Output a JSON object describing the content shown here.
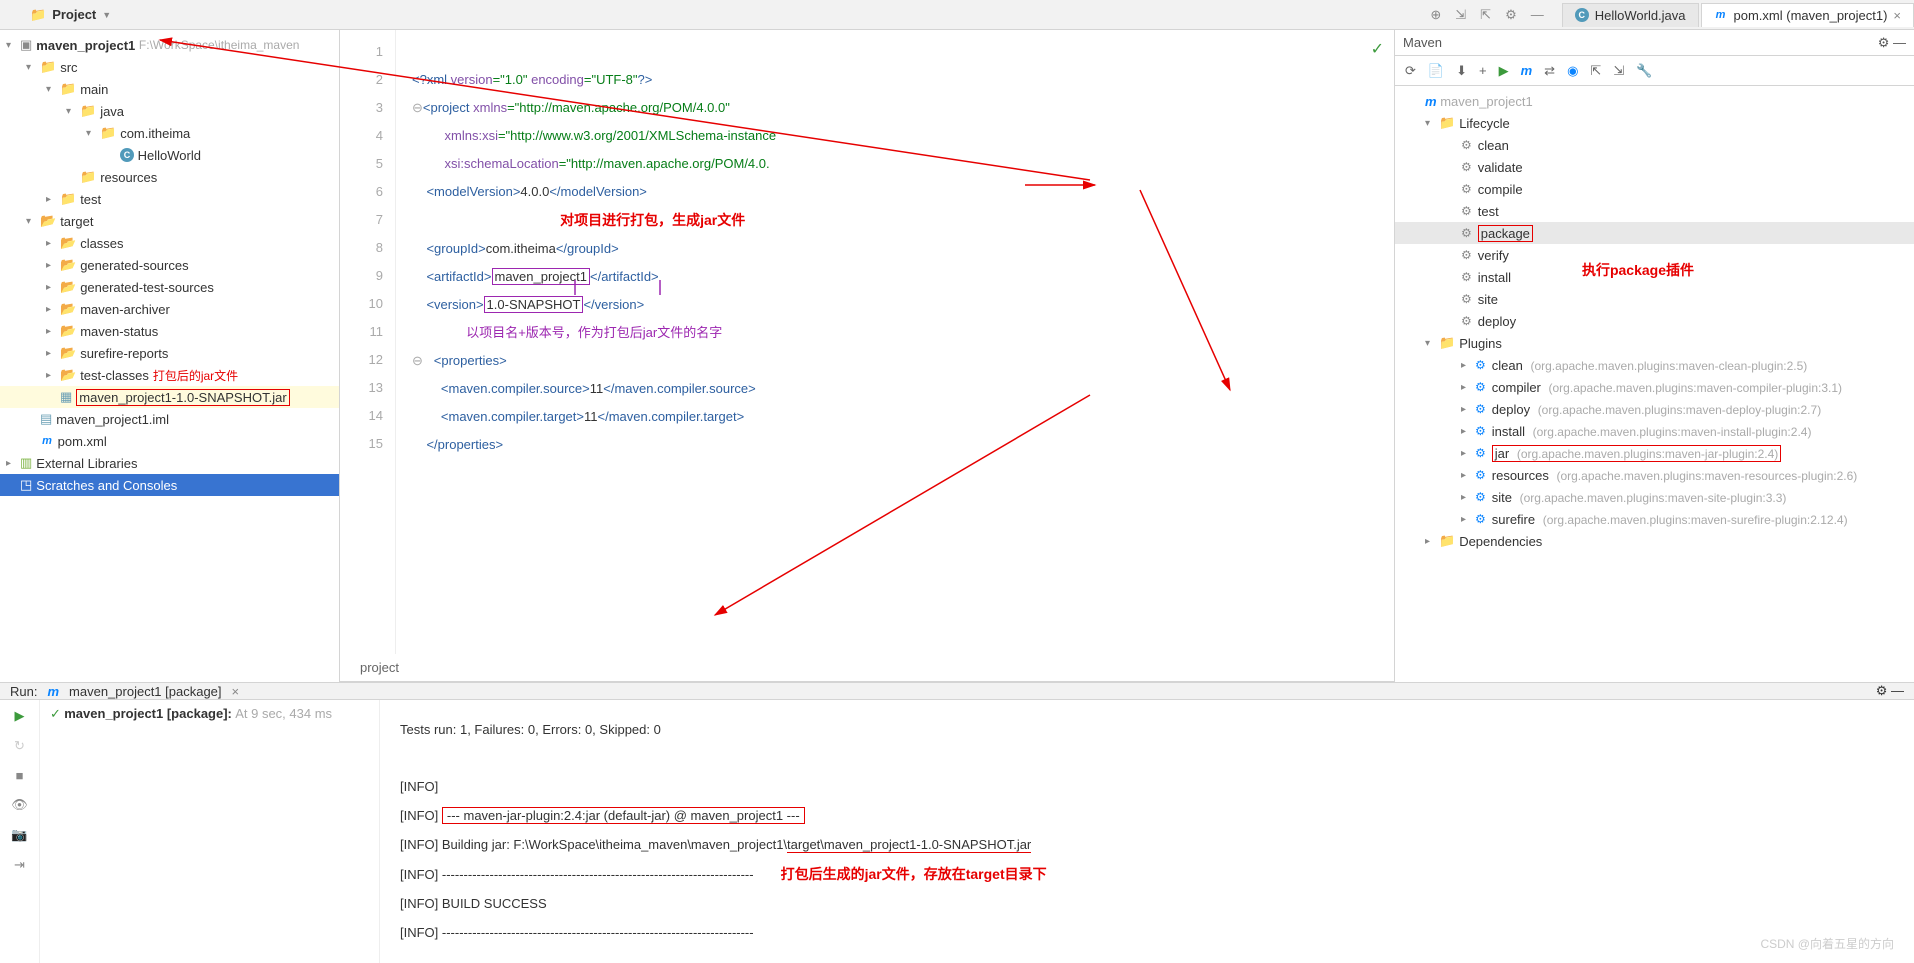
{
  "topbar": {
    "project_label": "Project"
  },
  "tabs": [
    {
      "icon": "java",
      "label": "HelloWorld.java",
      "active": false
    },
    {
      "icon": "maven",
      "label": "pom.xml (maven_project1)",
      "active": true
    }
  ],
  "project_tree": {
    "root": {
      "name": "maven_project1",
      "path": "F:\\WorkSpace\\itheima_maven"
    },
    "src": "src",
    "main": "main",
    "java": "java",
    "pkg": "com.itheima",
    "hello": "HelloWorld",
    "resources": "resources",
    "test": "test",
    "target": "target",
    "target_children": [
      "classes",
      "generated-sources",
      "generated-test-sources",
      "maven-archiver",
      "maven-status",
      "surefire-reports",
      "test-classes"
    ],
    "jar_ann": "打包后的jar文件",
    "jar_name": "maven_project1-1.0-SNAPSHOT.jar",
    "iml": "maven_project1.iml",
    "pom": "pom.xml",
    "ext": "External Libraries",
    "scratches": "Scratches and Consoles"
  },
  "code": {
    "breadcrumb": "project",
    "lines": [
      "1",
      "2",
      "3",
      "4",
      "5",
      "6",
      "7",
      "8",
      "9",
      "10",
      "11",
      "12",
      "13",
      "14",
      "15"
    ],
    "l1a": "<?xml ",
    "l1b": "version",
    "l1c": "=\"1.0\" ",
    "l1d": "encoding",
    "l1e": "=\"UTF-8\"",
    "l1f": "?>",
    "l2a": "<project ",
    "l2b": "xmlns",
    "l2c": "=\"http://maven.apache.org/POM/4.0.0\"",
    "l3a": "xmlns:xsi",
    "l3b": "=\"http://www.w3.org/2001/XMLSchema-instance",
    "l4a": "xsi:schemaLocation",
    "l4b": "=\"http://maven.apache.org/POM/4.0.",
    "l5a": "<modelVersion>",
    "l5b": "4.0.0",
    "l5c": "</modelVersion>",
    "l7a": "<groupId>",
    "l7b": "com.itheima",
    "l7c": "</groupId>",
    "l8a": "<artifactId>",
    "l8b": "maven_project1",
    "l8c": "</artifactId>",
    "l9a": "<version>",
    "l9b": "1.0-SNAPSHOT",
    "l9c": "</version>",
    "l11": "<properties>",
    "l12a": "<maven.compiler.source>",
    "l12b": "11",
    "l12c": "</maven.compiler.source>",
    "l13a": "<maven.compiler.target>",
    "l13b": "11",
    "l13c": "</maven.compiler.target>",
    "l14": "</properties>",
    "ann1": "对项目进行打包，生成jar文件",
    "ann2": "以项目名+版本号，作为打包后jar文件的名字",
    "ann3": "执行package插件"
  },
  "maven": {
    "title": "Maven",
    "proj": "maven_project1",
    "lifecycle": "Lifecycle",
    "goals": [
      "clean",
      "validate",
      "compile",
      "test",
      "package",
      "verify",
      "install",
      "site",
      "deploy"
    ],
    "plugins_label": "Plugins",
    "plugins": [
      {
        "name": "clean",
        "desc": "(org.apache.maven.plugins:maven-clean-plugin:2.5)"
      },
      {
        "name": "compiler",
        "desc": "(org.apache.maven.plugins:maven-compiler-plugin:3.1)"
      },
      {
        "name": "deploy",
        "desc": "(org.apache.maven.plugins:maven-deploy-plugin:2.7)"
      },
      {
        "name": "install",
        "desc": "(org.apache.maven.plugins:maven-install-plugin:2.4)"
      },
      {
        "name": "jar",
        "desc": "(org.apache.maven.plugins:maven-jar-plugin:2.4)"
      },
      {
        "name": "resources",
        "desc": "(org.apache.maven.plugins:maven-resources-plugin:2.6)"
      },
      {
        "name": "site",
        "desc": "(org.apache.maven.plugins:maven-site-plugin:3.3)"
      },
      {
        "name": "surefire",
        "desc": "(org.apache.maven.plugins:maven-surefire-plugin:2.12.4)"
      }
    ],
    "deps": "Dependencies"
  },
  "run": {
    "label": "Run:",
    "config": "maven_project1 [package]",
    "status": "maven_project1 [package]:",
    "status_meta": "At  9 sec, 434 ms",
    "lines": [
      "Tests run: 1, Failures: 0, Errors: 0, Skipped: 0",
      "",
      "[INFO]",
      "[INFO] ",
      "[INFO] Building jar: F:\\WorkSpace\\itheima_maven\\maven_project1\\",
      "[INFO] ------------------------------------------------------------------------",
      "[INFO] BUILD SUCCESS",
      "[INFO] ------------------------------------------------------------------------"
    ],
    "boxed": "--- maven-jar-plugin:2.4:jar (default-jar) @ maven_project1 ---",
    "jar_path": "target\\maven_project1-1.0-SNAPSHOT.jar",
    "ann": "打包后生成的jar文件，存放在target目录下"
  },
  "watermark": "CSDN @向着五星的方向"
}
